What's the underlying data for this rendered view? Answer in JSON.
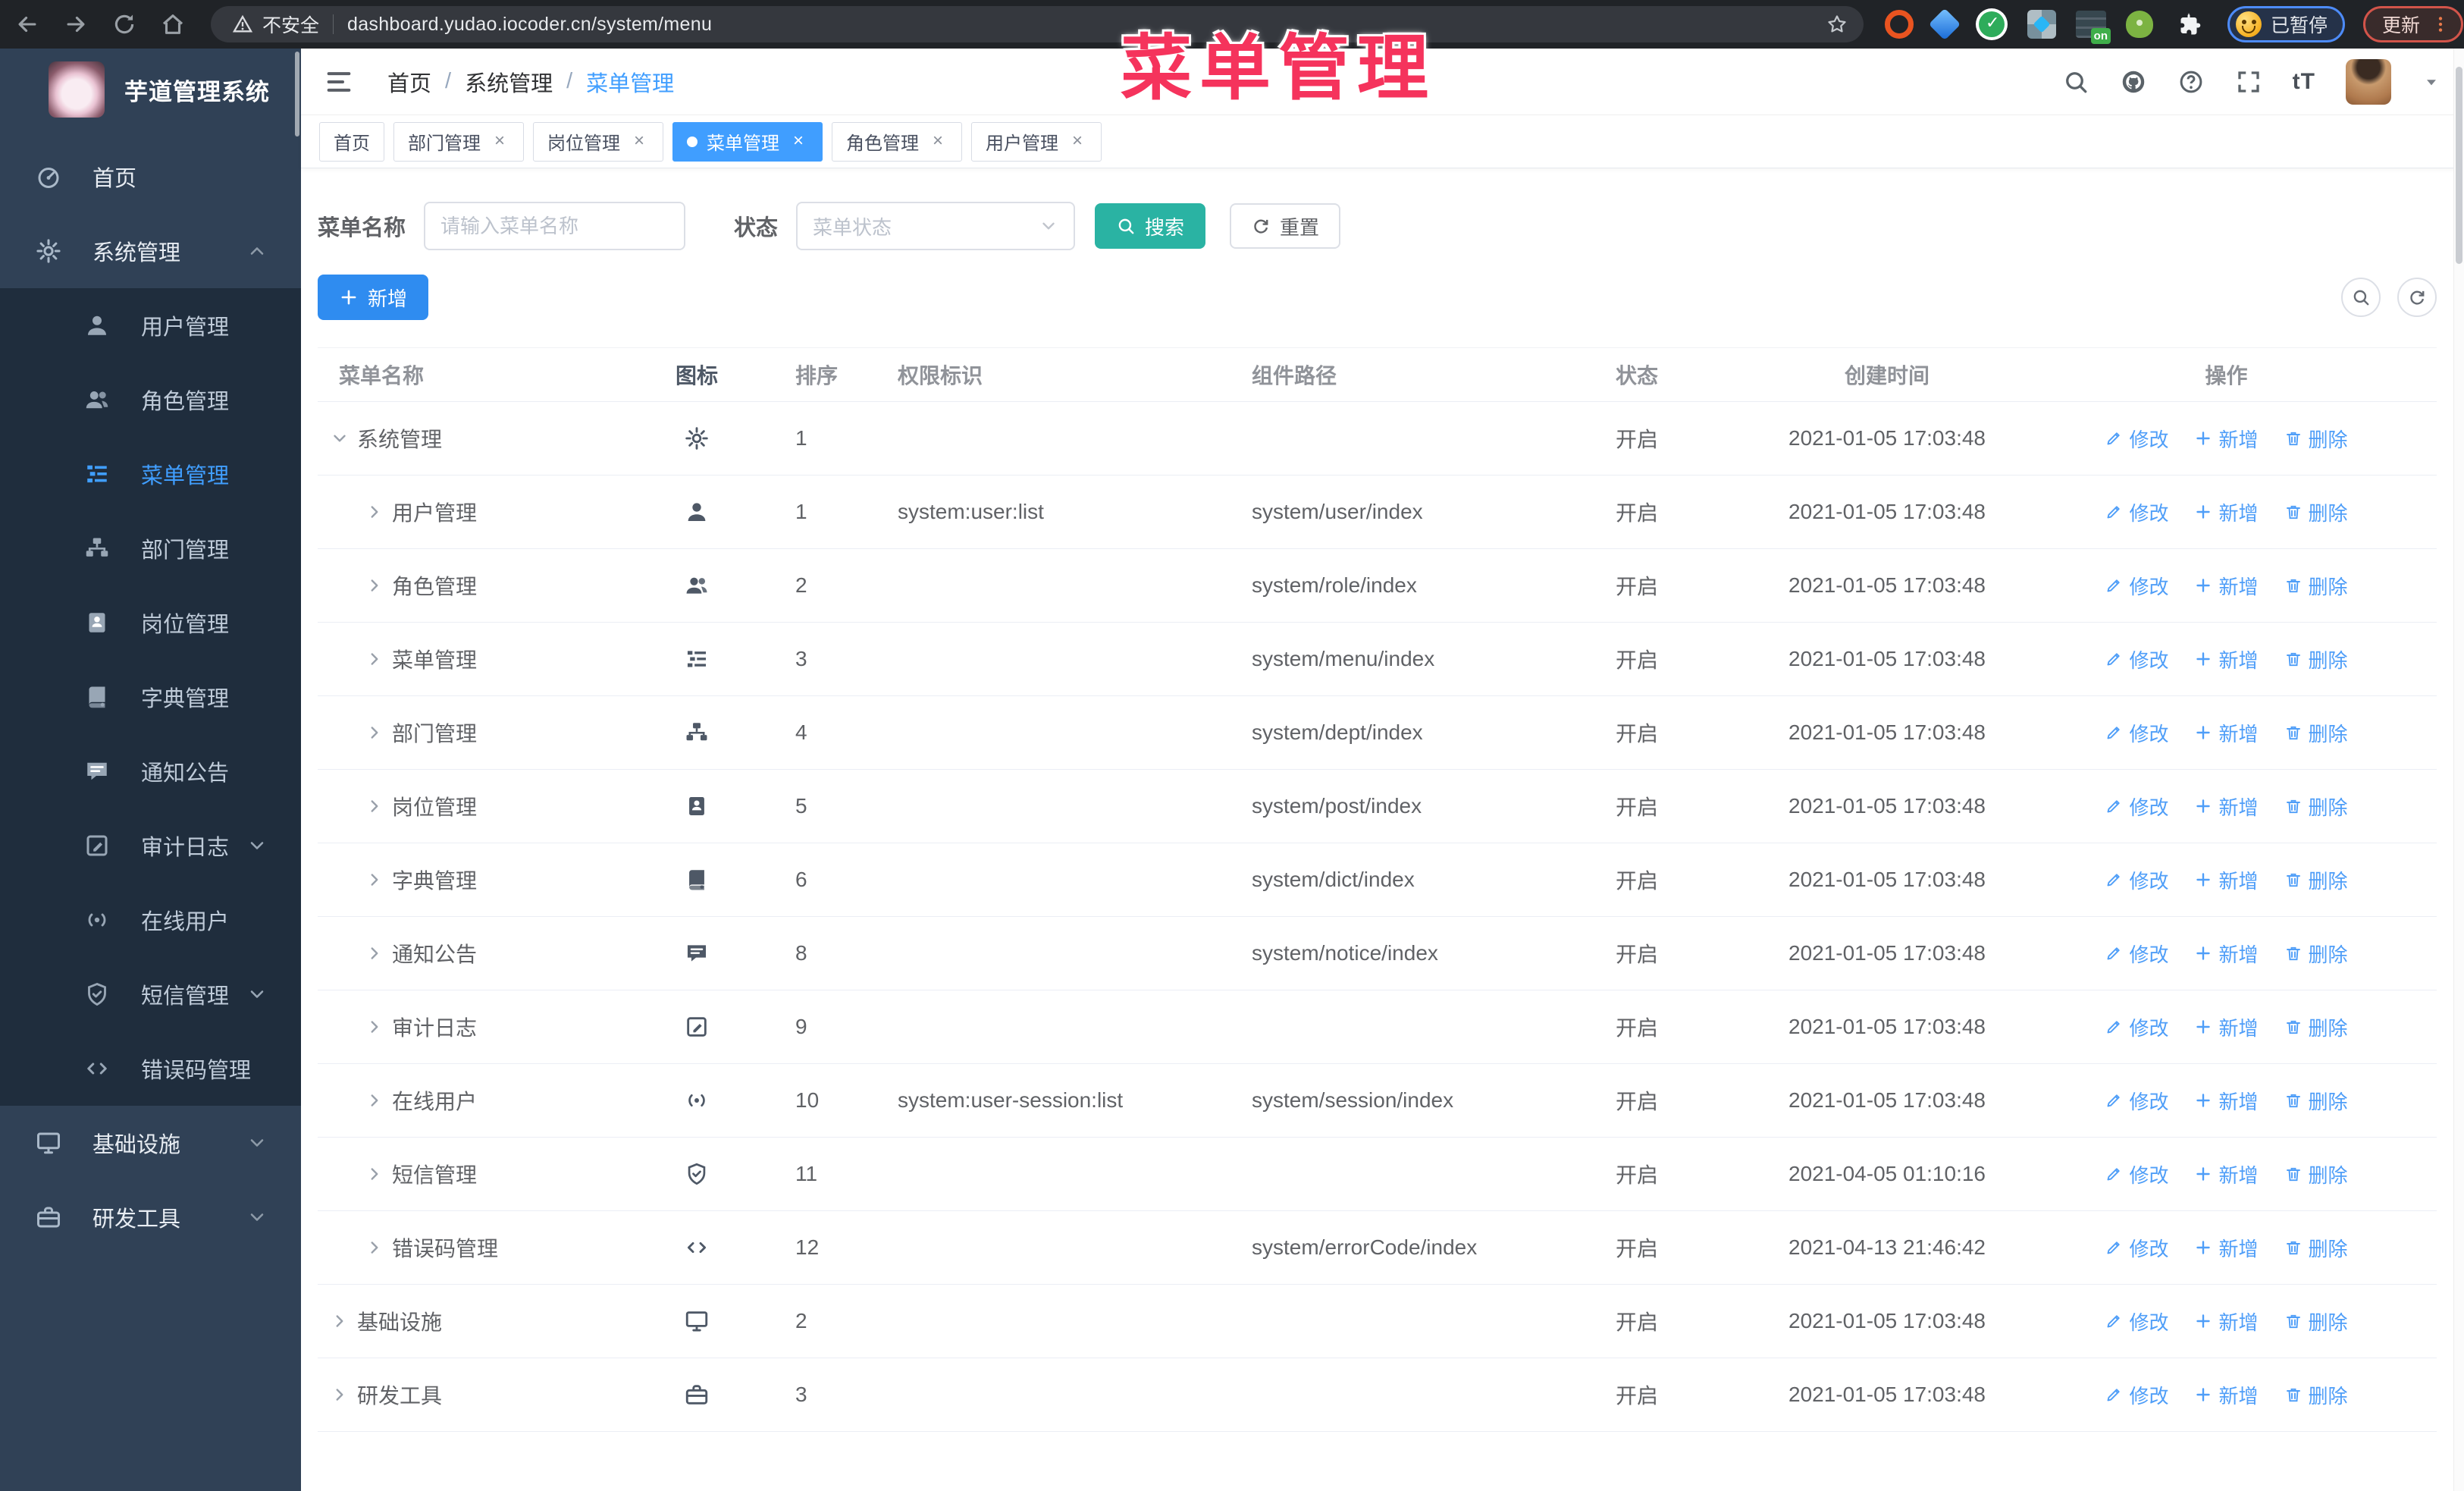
{
  "browser": {
    "security_label": "不安全",
    "url": "dashboard.yudao.iocoder.cn/system/menu",
    "extensions": [
      "ubuntu",
      "gem",
      "check",
      "grid",
      "tabs",
      "droid",
      "puzzle"
    ],
    "paused_badge": "已暂停",
    "update_badge": "更新"
  },
  "annotation": {
    "title": "菜单管理"
  },
  "sidebar": {
    "logo_title": "芋道管理系统",
    "items": [
      {
        "label": "首页",
        "icon": "dashboard",
        "type": "top"
      },
      {
        "label": "系统管理",
        "icon": "gear",
        "type": "top",
        "chevron": "up"
      },
      {
        "label": "用户管理",
        "icon": "user",
        "type": "sub"
      },
      {
        "label": "角色管理",
        "icon": "users",
        "type": "sub"
      },
      {
        "label": "菜单管理",
        "icon": "tree-table",
        "type": "sub",
        "active": true
      },
      {
        "label": "部门管理",
        "icon": "tree",
        "type": "sub"
      },
      {
        "label": "岗位管理",
        "icon": "post",
        "type": "sub"
      },
      {
        "label": "字典管理",
        "icon": "dict",
        "type": "sub"
      },
      {
        "label": "通知公告",
        "icon": "notice",
        "type": "sub"
      },
      {
        "label": "审计日志",
        "icon": "log",
        "type": "sub",
        "chevron": "down"
      },
      {
        "label": "在线用户",
        "icon": "online",
        "type": "sub"
      },
      {
        "label": "短信管理",
        "icon": "shield",
        "type": "sub",
        "chevron": "down"
      },
      {
        "label": "错误码管理",
        "icon": "code",
        "type": "sub"
      },
      {
        "label": "基础设施",
        "icon": "monitor",
        "type": "top",
        "chevron": "down"
      },
      {
        "label": "研发工具",
        "icon": "tool",
        "type": "top",
        "chevron": "down"
      }
    ]
  },
  "header": {
    "breadcrumbs": [
      "首页",
      "系统管理",
      "菜单管理"
    ]
  },
  "tags": [
    {
      "label": "首页",
      "closable": false,
      "active": false
    },
    {
      "label": "部门管理",
      "closable": true,
      "active": false
    },
    {
      "label": "岗位管理",
      "closable": true,
      "active": false
    },
    {
      "label": "菜单管理",
      "closable": true,
      "active": true
    },
    {
      "label": "角色管理",
      "closable": true,
      "active": false
    },
    {
      "label": "用户管理",
      "closable": true,
      "active": false
    }
  ],
  "filters": {
    "name_label": "菜单名称",
    "name_placeholder": "请输入菜单名称",
    "status_label": "状态",
    "status_placeholder": "菜单状态",
    "search_label": "搜索",
    "reset_label": "重置"
  },
  "toolbar": {
    "add_label": "新增"
  },
  "table": {
    "columns": [
      "菜单名称",
      "图标",
      "排序",
      "权限标识",
      "组件路径",
      "状态",
      "创建时间",
      "操作"
    ],
    "actions": {
      "edit": "修改",
      "add": "新增",
      "delete": "删除"
    },
    "rows": [
      {
        "name": "系统管理",
        "level": 0,
        "expanded": true,
        "icon": "gear",
        "sort": "1",
        "perm": "",
        "path": "",
        "status": "开启",
        "time": "2021-01-05 17:03:48"
      },
      {
        "name": "用户管理",
        "level": 1,
        "expanded": false,
        "icon": "user",
        "sort": "1",
        "perm": "system:user:list",
        "path": "system/user/index",
        "status": "开启",
        "time": "2021-01-05 17:03:48"
      },
      {
        "name": "角色管理",
        "level": 1,
        "expanded": false,
        "icon": "users",
        "sort": "2",
        "perm": "",
        "path": "system/role/index",
        "status": "开启",
        "time": "2021-01-05 17:03:48"
      },
      {
        "name": "菜单管理",
        "level": 1,
        "expanded": false,
        "icon": "tree-table",
        "sort": "3",
        "perm": "",
        "path": "system/menu/index",
        "status": "开启",
        "time": "2021-01-05 17:03:48"
      },
      {
        "name": "部门管理",
        "level": 1,
        "expanded": false,
        "icon": "tree",
        "sort": "4",
        "perm": "",
        "path": "system/dept/index",
        "status": "开启",
        "time": "2021-01-05 17:03:48"
      },
      {
        "name": "岗位管理",
        "level": 1,
        "expanded": false,
        "icon": "post",
        "sort": "5",
        "perm": "",
        "path": "system/post/index",
        "status": "开启",
        "time": "2021-01-05 17:03:48"
      },
      {
        "name": "字典管理",
        "level": 1,
        "expanded": false,
        "icon": "dict",
        "sort": "6",
        "perm": "",
        "path": "system/dict/index",
        "status": "开启",
        "time": "2021-01-05 17:03:48"
      },
      {
        "name": "通知公告",
        "level": 1,
        "expanded": false,
        "icon": "notice",
        "sort": "8",
        "perm": "",
        "path": "system/notice/index",
        "status": "开启",
        "time": "2021-01-05 17:03:48"
      },
      {
        "name": "审计日志",
        "level": 1,
        "expanded": false,
        "icon": "log",
        "sort": "9",
        "perm": "",
        "path": "",
        "status": "开启",
        "time": "2021-01-05 17:03:48"
      },
      {
        "name": "在线用户",
        "level": 1,
        "expanded": false,
        "icon": "online",
        "sort": "10",
        "perm": "system:user-session:list",
        "path": "system/session/index",
        "status": "开启",
        "time": "2021-01-05 17:03:48"
      },
      {
        "name": "短信管理",
        "level": 1,
        "expanded": false,
        "icon": "shield",
        "sort": "11",
        "perm": "",
        "path": "",
        "status": "开启",
        "time": "2021-04-05 01:10:16"
      },
      {
        "name": "错误码管理",
        "level": 1,
        "expanded": false,
        "icon": "code",
        "sort": "12",
        "perm": "",
        "path": "system/errorCode/index",
        "status": "开启",
        "time": "2021-04-13 21:46:42"
      },
      {
        "name": "基础设施",
        "level": 0,
        "expanded": false,
        "icon": "monitor",
        "sort": "2",
        "perm": "",
        "path": "",
        "status": "开启",
        "time": "2021-01-05 17:03:48"
      },
      {
        "name": "研发工具",
        "level": 0,
        "expanded": false,
        "icon": "tool",
        "sort": "3",
        "perm": "",
        "path": "",
        "status": "开启",
        "time": "2021-01-05 17:03:48"
      }
    ]
  }
}
